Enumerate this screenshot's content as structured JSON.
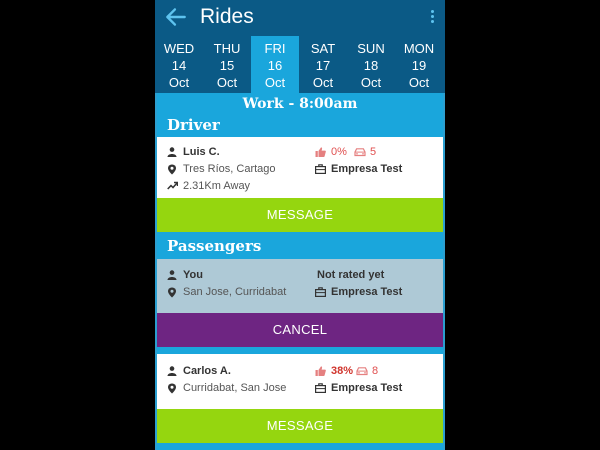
{
  "header": {
    "title": "Rides"
  },
  "days": [
    {
      "name": "WED",
      "day": "14",
      "month": "Oct"
    },
    {
      "name": "THU",
      "day": "15",
      "month": "Oct"
    },
    {
      "name": "FRI",
      "day": "16",
      "month": "Oct"
    },
    {
      "name": "SAT",
      "day": "17",
      "month": "Oct"
    },
    {
      "name": "SUN",
      "day": "18",
      "month": "Oct"
    },
    {
      "name": "MON",
      "day": "19",
      "month": "Oct"
    }
  ],
  "selected_day": "FRI",
  "schedule": {
    "title": "Work - 8:00am"
  },
  "driver": {
    "section_title": "Driver",
    "name": "Luis C.",
    "location": "Tres Ríos, Cartago",
    "distance": "2.31Km Away",
    "rating": "0%",
    "rides": "5",
    "company": "Empresa Test",
    "button_label": "MESSAGE"
  },
  "passengers": {
    "section_title": "Passengers",
    "items": [
      {
        "name": "You",
        "location": "San Jose, Curridabat",
        "rating_text": "Not rated yet",
        "company": "Empresa Test",
        "button_label": "CANCEL"
      },
      {
        "name": "Carlos A.",
        "location": "Curridabat, San Jose",
        "rating": "38%",
        "rides": "8",
        "company": "Empresa Test",
        "button_label": "MESSAGE"
      }
    ]
  },
  "colors": {
    "header_bg": "#0b5a86",
    "body_bg": "#1aa6dc",
    "message_button": "#95d60f",
    "cancel_button": "#6e2582",
    "current_user_card": "#aec9d6"
  },
  "icons": {
    "back": "arrow-left-icon",
    "menu": "more-vert-icon",
    "person": "person-icon",
    "location": "map-pin-icon",
    "distance": "trending-up-icon",
    "rating": "thumbs-up-icon",
    "rides": "car-icon",
    "company": "briefcase-icon"
  }
}
